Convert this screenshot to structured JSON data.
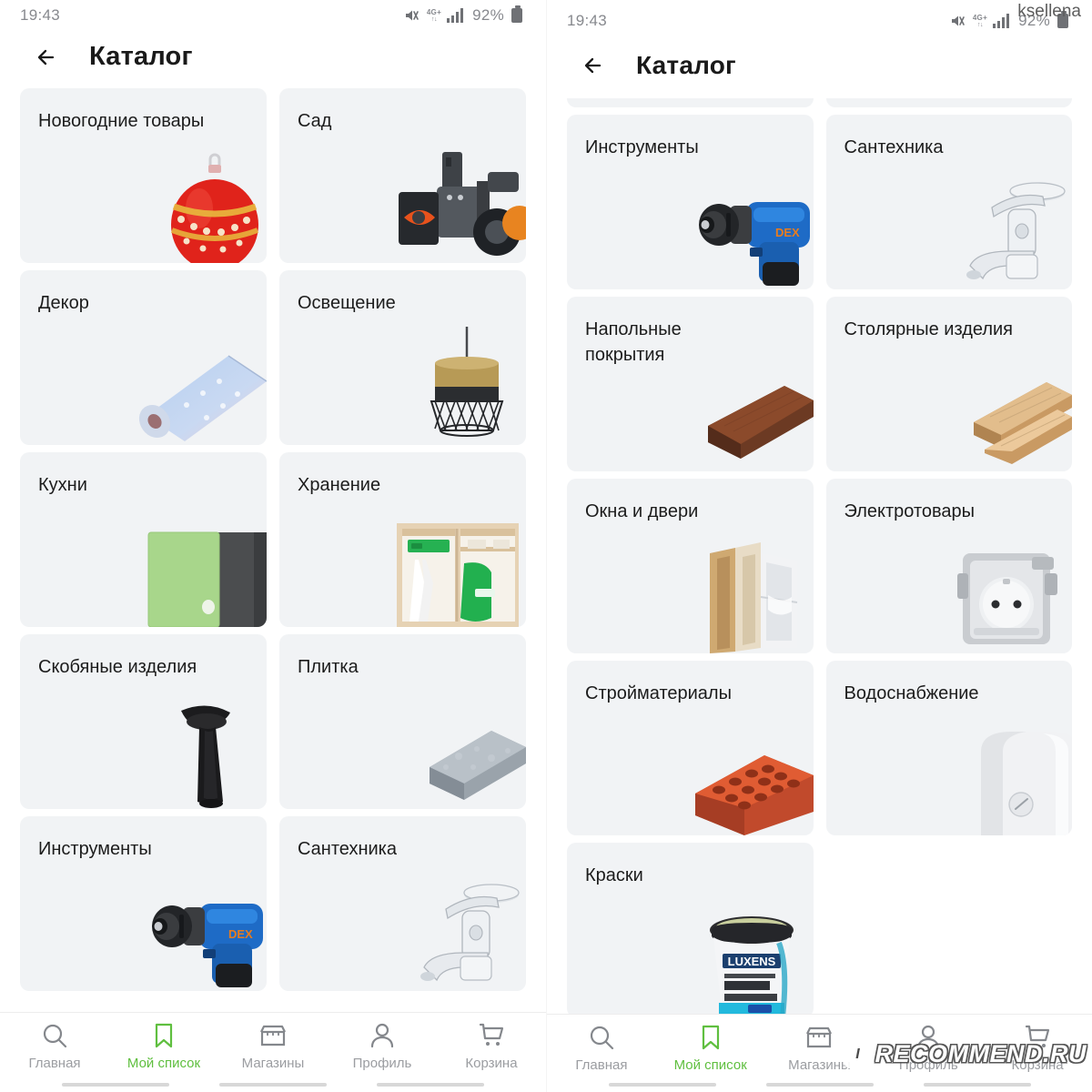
{
  "left": {
    "status": {
      "clock": "19:43",
      "battery_percent": "92%",
      "network": "4G+",
      "icons": [
        "mute-icon",
        "network-4g-icon",
        "signal-bars-icon",
        "battery-icon"
      ]
    },
    "header": {
      "title": "Каталог",
      "back_icon": "arrow-left-icon"
    },
    "cards": [
      {
        "title": "Новогодние товары",
        "art": "christmas-ball"
      },
      {
        "title": "Сад",
        "art": "snow-blower"
      },
      {
        "title": "Декор",
        "art": "wallpaper-roll"
      },
      {
        "title": "Освещение",
        "art": "pendant-lamp"
      },
      {
        "title": "Кухни",
        "art": "kitchen-cabinet"
      },
      {
        "title": "Хранение",
        "art": "wardrobe"
      },
      {
        "title": "Скобяные изделия",
        "art": "door-handle"
      },
      {
        "title": "Плитка",
        "art": "stone-tile"
      },
      {
        "title": "Инструменты",
        "art": "cordless-drill"
      },
      {
        "title": "Сантехника",
        "art": "faucet"
      }
    ],
    "bottom_nav": [
      {
        "label": "Главная",
        "icon": "search-icon",
        "active": false
      },
      {
        "label": "Мой список",
        "icon": "bookmark-icon",
        "active": true
      },
      {
        "label": "Магазины",
        "icon": "store-icon",
        "active": false
      },
      {
        "label": "Профиль",
        "icon": "person-icon",
        "active": false
      },
      {
        "label": "Корзина",
        "icon": "cart-icon",
        "active": false
      }
    ]
  },
  "right": {
    "status": {
      "clock": "19:43",
      "battery_percent": "92%",
      "network": "4G+",
      "icons": [
        "mute-icon",
        "network-4g-icon",
        "signal-bars-icon",
        "battery-icon"
      ]
    },
    "header": {
      "title": "Каталог",
      "back_icon": "arrow-left-icon"
    },
    "cards": [
      {
        "title": "Инструменты",
        "art": "cordless-drill"
      },
      {
        "title": "Сантехника",
        "art": "faucet"
      },
      {
        "title": "Напольные\nпокрытия",
        "art": "laminate-plank"
      },
      {
        "title": "Столярные изделия",
        "art": "wood-boards"
      },
      {
        "title": "Окна и двери",
        "art": "door-frame"
      },
      {
        "title": "Электротовары",
        "art": "wall-socket"
      },
      {
        "title": "Стройматериалы",
        "art": "brick"
      },
      {
        "title": "Водоснабжение",
        "art": "water-heater"
      },
      {
        "title": "Краски",
        "art": "paint-bucket"
      }
    ],
    "bottom_nav": [
      {
        "label": "Главная",
        "icon": "search-icon",
        "active": false
      },
      {
        "label": "Мой список",
        "icon": "bookmark-icon",
        "active": true
      },
      {
        "label": "Магазины",
        "icon": "store-icon",
        "active": false
      },
      {
        "label": "Профиль",
        "icon": "person-icon",
        "active": false
      },
      {
        "label": "Корзина",
        "icon": "cart-icon",
        "active": false
      }
    ]
  },
  "watermarks": {
    "username": "ksellena",
    "site_badge": "I",
    "site": "RECOMMEND.RU"
  },
  "colors": {
    "accent_green": "#5fbf3f",
    "card_bg": "#f1f3f5",
    "text_primary": "#1c1c1c",
    "text_muted": "#9b9da1"
  }
}
